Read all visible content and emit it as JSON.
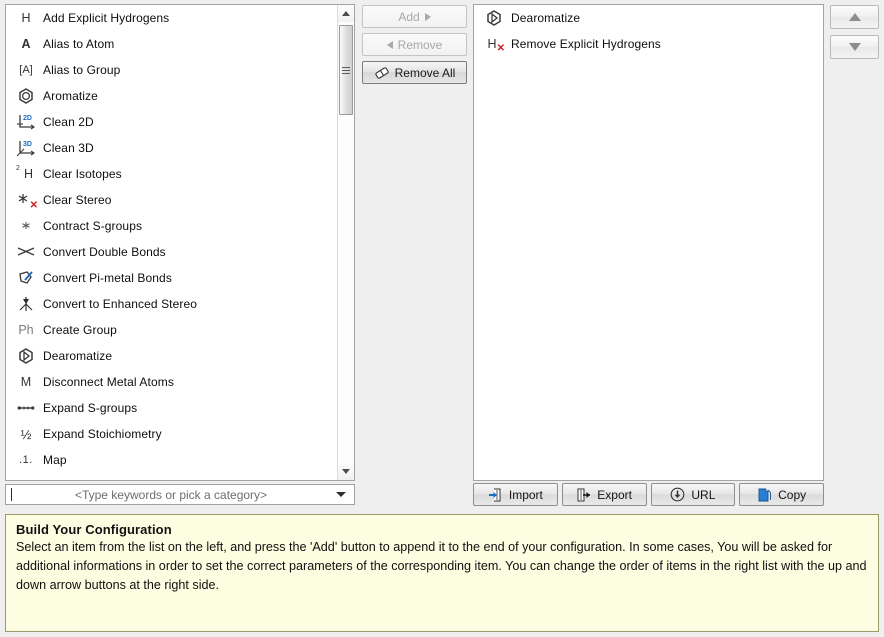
{
  "left_list": {
    "items": [
      {
        "icon": "hydrogen-letter-icon",
        "label": "Add Explicit Hydrogens"
      },
      {
        "icon": "atom-letter-a-icon",
        "label": "Alias to Atom"
      },
      {
        "icon": "bracketed-a-icon",
        "label": "Alias to Group"
      },
      {
        "icon": "aromatic-ring-icon",
        "label": "Aromatize"
      },
      {
        "icon": "axes-2d-icon",
        "label": "Clean 2D"
      },
      {
        "icon": "axes-3d-icon",
        "label": "Clean 3D"
      },
      {
        "icon": "isotope-h-icon",
        "label": "Clear Isotopes"
      },
      {
        "icon": "stereo-star-x-icon",
        "label": "Clear Stereo"
      },
      {
        "icon": "contract-sgroup-icon",
        "label": "Contract S-groups"
      },
      {
        "icon": "double-bond-cross-icon",
        "label": "Convert Double Bonds"
      },
      {
        "icon": "pi-metal-bond-icon",
        "label": "Convert Pi-metal Bonds"
      },
      {
        "icon": "enhanced-stereo-icon",
        "label": "Convert to Enhanced Stereo"
      },
      {
        "icon": "phenyl-group-icon",
        "label": "Create Group"
      },
      {
        "icon": "dearomatize-ring-icon",
        "label": "Dearomatize"
      },
      {
        "icon": "metal-letter-m-icon",
        "label": "Disconnect Metal Atoms"
      },
      {
        "icon": "expand-sgroup-icon",
        "label": "Expand S-groups"
      },
      {
        "icon": "one-half-fraction-icon",
        "label": "Expand Stoichiometry"
      },
      {
        "icon": "map-numbering-icon",
        "label": "Map"
      }
    ]
  },
  "filter": {
    "placeholder": "<Type keywords or pick a category>",
    "value": ""
  },
  "transfer_buttons": {
    "add": {
      "label": "Add",
      "enabled": false
    },
    "remove": {
      "label": "Remove",
      "enabled": false
    },
    "remove_all": {
      "label": "Remove All",
      "enabled": true
    }
  },
  "right_list": {
    "items": [
      {
        "icon": "dearomatize-ring-icon",
        "label": "Dearomatize"
      },
      {
        "icon": "remove-hydrogens-icon",
        "label": "Remove Explicit Hydrogens"
      }
    ]
  },
  "order_buttons": {
    "move_up": {
      "name": "move-up",
      "enabled": false
    },
    "move_down": {
      "name": "move-down",
      "enabled": false
    }
  },
  "io_buttons": [
    {
      "icon": "import-icon",
      "label": "Import"
    },
    {
      "icon": "export-icon",
      "label": "Export"
    },
    {
      "icon": "url-download-icon",
      "label": "URL"
    },
    {
      "icon": "copy-icon",
      "label": "Copy"
    }
  ],
  "info": {
    "title": "Build Your Configuration",
    "body": "Select an item from the list on the left, and press the 'Add' button to append it to the end of your configuration. In some cases, You will be asked for additional informations in order to set the correct parameters of the corresponding item. You can change the order of items in the right list with the up and down arrow buttons at the right side."
  },
  "colors": {
    "info_background": "#fdfde1",
    "info_border": "#9a9a6a",
    "accent_blue": "#1a6fc4",
    "accent_red": "#cc1f1f",
    "panel_background": "#efeff0"
  }
}
